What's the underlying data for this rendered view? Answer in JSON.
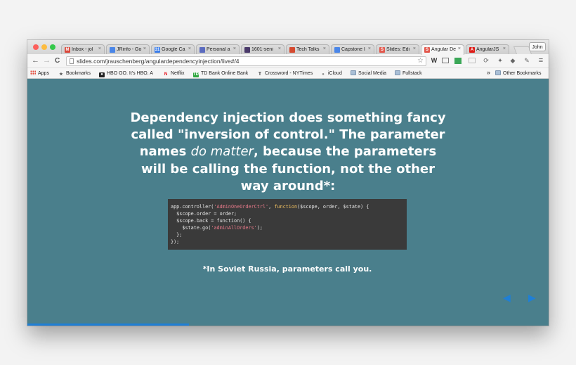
{
  "window": {
    "user_label": "John"
  },
  "tabs": [
    {
      "title": "Inbox - jol",
      "icon": "gmail-icon",
      "color": "#d9483b",
      "glyph": "M",
      "active": false
    },
    {
      "title": "JRinfo - Go",
      "icon": "google-docs-icon",
      "color": "#4a86e8",
      "glyph": "",
      "active": false
    },
    {
      "title": "Google Ca",
      "icon": "google-calendar-icon",
      "color": "#3b7de9",
      "glyph": "31",
      "active": false
    },
    {
      "title": "Personal a",
      "icon": "document-icon",
      "color": "#5b6bbf",
      "glyph": "",
      "active": false
    },
    {
      "title": "1601-seni",
      "icon": "github-icon",
      "color": "#4a3a6a",
      "glyph": "",
      "active": false
    },
    {
      "title": "Tech Talks",
      "icon": "diamond-icon",
      "color": "#d54a30",
      "glyph": "",
      "active": false
    },
    {
      "title": "Capstone I",
      "icon": "google-docs-icon",
      "color": "#4a86e8",
      "glyph": "",
      "active": false
    },
    {
      "title": "Slides: Edi",
      "icon": "slides-icon",
      "color": "#e2574c",
      "glyph": "S",
      "active": false
    },
    {
      "title": "Angular De",
      "icon": "slides-icon",
      "color": "#e2574c",
      "glyph": "S",
      "active": true
    },
    {
      "title": "AngularJS",
      "icon": "angular-icon",
      "color": "#dd1b16",
      "glyph": "A",
      "active": false
    }
  ],
  "toolbar": {
    "back": "←",
    "forward": "→",
    "reload": "C",
    "url": "slides.com/jrauschenberg/angulardependencyinjection/live#/4",
    "star": "☆",
    "menu": "≡"
  },
  "bookmarks": {
    "items": [
      {
        "label": "Apps",
        "icon": "apps-icon"
      },
      {
        "label": "Bookmarks",
        "icon": "star-icon"
      },
      {
        "label": "HBO GO. It's HBO. A",
        "icon": "hbo-icon"
      },
      {
        "label": "Netflix",
        "icon": "netflix-icon"
      },
      {
        "label": "TD Bank Online Bank",
        "icon": "td-bank-icon"
      },
      {
        "label": "Crossword - NYTimes",
        "icon": "nytimes-icon"
      },
      {
        "label": "iCloud",
        "icon": "apple-icon"
      },
      {
        "label": "Social Media",
        "icon": "folder-icon"
      },
      {
        "label": "Fullstack",
        "icon": "folder-icon"
      }
    ],
    "overflow": "»",
    "other": "Other Bookmarks"
  },
  "slide": {
    "headline_part1": "Dependency injection does something fancy called \"inversion of control.\" The parameter names ",
    "headline_emphasis": "do matter",
    "headline_part2": ", because the parameters will be calling the function, not the other way around*:",
    "code": [
      [
        "app.controller(",
        {
          "s": "'AdminOneOrderCtrl'"
        },
        ", ",
        {
          "k": "function"
        },
        "($scope, order, $state) {"
      ],
      [
        "  $scope.order = order;"
      ],
      [
        "  $scope.back = function() {"
      ],
      [
        "    $state.go(",
        {
          "s": "'adminAllOrders'"
        },
        ");"
      ],
      [
        "  };"
      ],
      [
        "});"
      ]
    ],
    "footnote": "*In Soviet Russia, parameters call you.",
    "nav_prev": "◀",
    "nav_next": "▶",
    "progress_fraction": 0.31
  }
}
